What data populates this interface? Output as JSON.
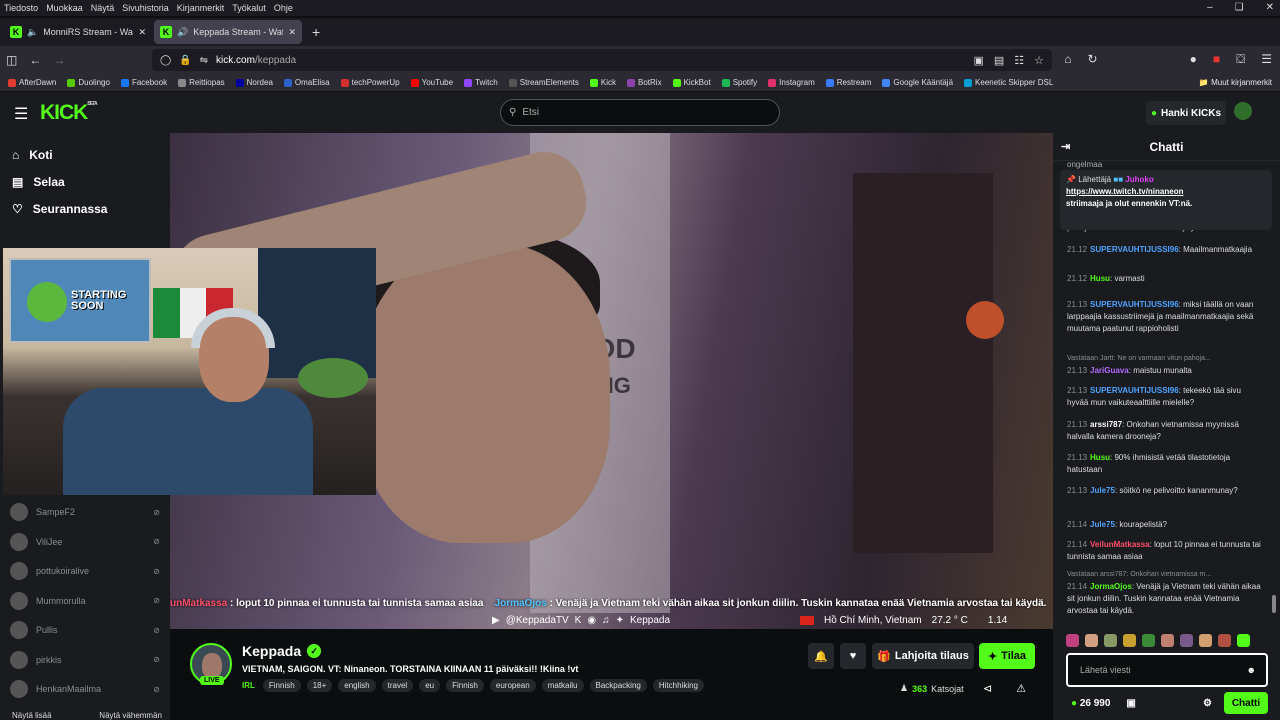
{
  "menubar": [
    "Tiedosto",
    "Muokkaa",
    "Näytä",
    "Sivuhistoria",
    "Kirjanmerkit",
    "Työkalut",
    "Ohje"
  ],
  "tabs": [
    {
      "label": "MonniRS Stream - Watch Li"
    },
    {
      "label": "Keppada Stream - Watch Li"
    }
  ],
  "url": {
    "domain": "kick.com",
    "path": "/keppada"
  },
  "bookmarks": [
    {
      "label": "AfterDawn",
      "color": "#e03c31"
    },
    {
      "label": "Duolingo",
      "color": "#58cc02"
    },
    {
      "label": "Facebook",
      "color": "#1877f2"
    },
    {
      "label": "Reittiopas",
      "color": "#888888"
    },
    {
      "label": "Nordea",
      "color": "#0000a0"
    },
    {
      "label": "OmaElisa",
      "color": "#2a62c9"
    },
    {
      "label": "techPowerUp",
      "color": "#d32f2f"
    },
    {
      "label": "YouTube",
      "color": "#ff0000"
    },
    {
      "label": "Twitch",
      "color": "#9146ff"
    },
    {
      "label": "StreamElements",
      "color": "#555555"
    },
    {
      "label": "Kick",
      "color": "#53fc18"
    },
    {
      "label": "BotRix",
      "color": "#8e44ad"
    },
    {
      "label": "KickBot",
      "color": "#53fc18"
    },
    {
      "label": "Spotify",
      "color": "#1db954"
    },
    {
      "label": "Instagram",
      "color": "#e1306c"
    },
    {
      "label": "Restream",
      "color": "#3a7bfd"
    },
    {
      "label": "Google Kääntäjä",
      "color": "#4285f4"
    },
    {
      "label": "Keenetic Skipper DSL",
      "color": "#00a0d6"
    }
  ],
  "bookmarks_more": "Muut kirjanmerkit",
  "header": {
    "logo": "KICK",
    "beta": "BETA",
    "search_placeholder": "Etsi",
    "kicks_button": "Hanki KICKs"
  },
  "sidebar": {
    "nav": [
      {
        "label": "Koti",
        "icon": "home-icon"
      },
      {
        "label": "Selaa",
        "icon": "browse-icon"
      },
      {
        "label": "Seurannassa",
        "icon": "heart-icon"
      }
    ],
    "channels": [
      "SampeF2",
      "ViliJee",
      "pottukoiralive",
      "Mummorulla",
      "Pullis",
      "pirkkis",
      "HenkanMaailma"
    ],
    "show_more": "Näytä lisää",
    "show_less": "Näytä vähemmän"
  },
  "video": {
    "overlay_user1": "unMatkassa",
    "overlay_text1": " : loput 10 pinnaa ei tunnusta tai tunnista samaa asiaa",
    "overlay_user2": "JormaOjos",
    "overlay_text2": " : Venäjä ja Vietnam teki vähän aikaa sit jonkun diilin. Tuskin kannataa enää Vietnamia arvostaa tai käydä.",
    "handle": "@KeppadaTV",
    "handle2": "Keppada",
    "location": "Hồ Chí Minh, Vietnam",
    "temp": "27.2 ° C",
    "time": "1.14",
    "poster_text": "STARTING SOON"
  },
  "stream": {
    "name": "Keppada",
    "live": "LIVE",
    "title": "VIETNAM, SAIGON. VT: Ninaneon. TORSTAINA KIINAAN 11 päiväksi!! !Kiina !vt",
    "category": "IRL",
    "tags": [
      "Finnish",
      "18+",
      "english",
      "travel",
      "eu",
      "Finnish",
      "european",
      "matkailu",
      "Backpacking",
      "Hitchhiking"
    ],
    "gift_label": "Lahjoita tilaus",
    "sub_label": "Tilaa",
    "viewers": "363",
    "viewers_label": "Katsojat"
  },
  "chat": {
    "title": "Chatti",
    "pinned": {
      "prefix": "Lähettäjä",
      "user": "Juhoko",
      "link": "https://www.twitch.tv/ninaneon",
      "text": "striimaaja ja olut ennenkin VT:nä."
    },
    "top_cut": "ongelmaa",
    "messages": [
      {
        "time": "",
        "user": "",
        "color": "#ffffff",
        "text": "pahoja ne munat missä on kehittynyt sikiö"
      },
      {
        "time": "21.12",
        "user": "SUPERVAUHTIJUSSI96",
        "color": "#4fa3ff",
        "text": "Maailmanmatkaajia"
      },
      {
        "time": "21.12",
        "user": "Husu",
        "color": "#53fc18",
        "text": "varmasti"
      },
      {
        "time": "21.13",
        "user": "SUPERVAUHTIJUSSI96",
        "color": "#4fa3ff",
        "text": "miksi täällä on vaan larppaajia kassustriimejä ja maailmanmatkaajia sekä muutama paatunut rappioholisti"
      },
      {
        "time": "21.13",
        "user": "JariGuava",
        "color": "#b36bff",
        "text": "maistuu munalta",
        "reply": "Vastataan Jartt: Ne on varmaan vitun pahoja..."
      },
      {
        "time": "21.13",
        "user": "SUPERVAUHTIJUSSI96",
        "color": "#4fa3ff",
        "text": "tekeekö tää sivu hyvää mun vaikuteaalttiille mielelle?"
      },
      {
        "time": "21.13",
        "user": "arssi787",
        "color": "#ffffff",
        "text": "Onkohan vietnamissa myynissä halvalla kamera drooneja?"
      },
      {
        "time": "21.13",
        "user": "Husu",
        "color": "#53fc18",
        "text": "90% ihmisistä vetää tilastotietoja hatustaan"
      },
      {
        "time": "21.13",
        "user": "Jule75",
        "color": "#4fa3ff",
        "text": "söitkö ne pelivoitto kananmunay?"
      },
      {
        "time": "21.14",
        "user": "Jule75",
        "color": "#4fa3ff",
        "text": "kourapelistä?"
      },
      {
        "time": "21.14",
        "user": "VeilunMatkassa",
        "color": "#ff4f6a",
        "text": "loput 10 pinnaa ei tunnusta tai tunnista samaa asiaa"
      },
      {
        "time": "21.14",
        "user": "JormaOjos",
        "color": "#53fc18",
        "text": "Venäjä ja Vietnam teki vähän aikaa sit jonkun diilin. Tuskin kannataa enää Vietnamia arvostaa tai käydä.",
        "reply": "Vastataan arssi787: Onkohan vietnamissa m..."
      }
    ],
    "input_placeholder": "Lähetä viesti",
    "points": "26 990",
    "send_label": "Chatti"
  }
}
